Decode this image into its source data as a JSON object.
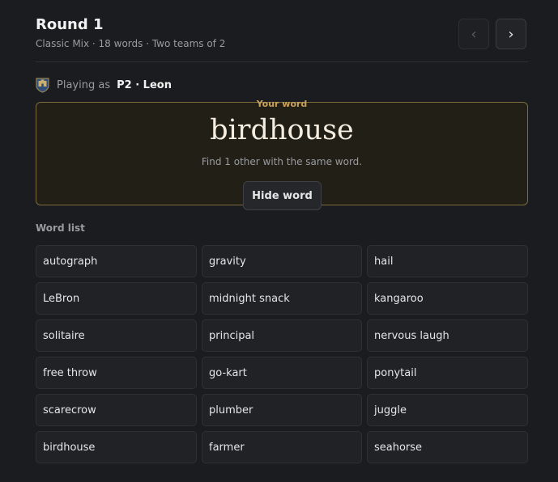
{
  "header": {
    "title": "Round 1",
    "subtitle": "Classic Mix · 18 words · Two teams of 2",
    "prev_label": "‹",
    "next_label": "›"
  },
  "player": {
    "label": "Playing as",
    "name": "P2 · Leon",
    "icon": "shield-icon"
  },
  "word_card": {
    "tag": "Your word",
    "word": "birdhouse",
    "hint": "Find 1 other with the same word.",
    "hide_label": "Hide word"
  },
  "word_list": {
    "label": "Word list",
    "words": [
      "autograph",
      "gravity",
      "hail",
      "LeBron",
      "midnight snack",
      "kangaroo",
      "solitaire",
      "principal",
      "nervous laugh",
      "free throw",
      "go-kart",
      "ponytail",
      "scarecrow",
      "plumber",
      "juggle",
      "birdhouse",
      "farmer",
      "seahorse"
    ]
  },
  "colors": {
    "background": "#1b1c20",
    "accent_gold": "#c8a25c",
    "card_border": "#7d6a3e"
  }
}
